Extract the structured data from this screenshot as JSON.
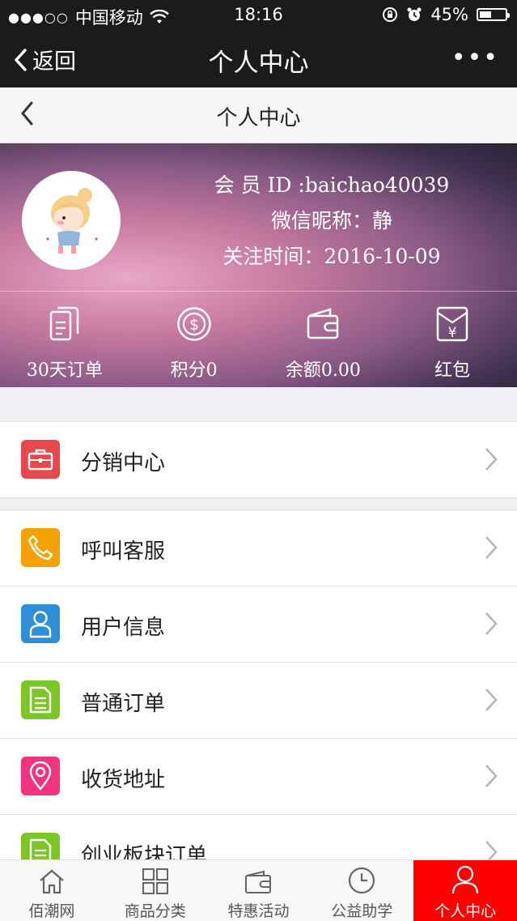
{
  "status": {
    "carrier": "中国移动",
    "time": "18:16",
    "battery": "45%"
  },
  "nav": {
    "back_label": "返回",
    "title": "个人中心",
    "more": "•••"
  },
  "subnav": {
    "title": "个人中心"
  },
  "profile": {
    "member_id": "会 员 ID :baichao40039",
    "nickname": "微信昵称：静",
    "follow_time": "关注时间：2016-10-09"
  },
  "stats": [
    {
      "label": "30天订单",
      "icon": "document-icon"
    },
    {
      "label": "积分0",
      "icon": "dollar-coin-icon"
    },
    {
      "label": "余额0.00",
      "icon": "wallet-icon"
    },
    {
      "label": "红包",
      "icon": "yen-envelope-icon"
    }
  ],
  "menu_group1": [
    {
      "label": "分销中心",
      "icon": "briefcase-icon",
      "color": "#e8474b"
    }
  ],
  "menu_group2": [
    {
      "label": "呼叫客服",
      "icon": "phone-icon",
      "color": "#f5a200"
    },
    {
      "label": "用户信息",
      "icon": "user-icon",
      "color": "#2f8fd6"
    },
    {
      "label": "普通订单",
      "icon": "order-icon",
      "color": "#7cc627"
    },
    {
      "label": "收货地址",
      "icon": "location-pin-icon",
      "color": "#f0347e"
    },
    {
      "label": "创业板块订单",
      "icon": "order-icon",
      "color": "#7cc627"
    }
  ],
  "tabs": [
    {
      "label": "佰潮网",
      "icon": "home-icon"
    },
    {
      "label": "商品分类",
      "icon": "grid-icon"
    },
    {
      "label": "特惠活动",
      "icon": "wallet-icon"
    },
    {
      "label": "公益助学",
      "icon": "clock-icon"
    },
    {
      "label": "个人中心",
      "icon": "person-icon",
      "active": true
    }
  ],
  "colors": {
    "active_tab": "#ff0000",
    "dark_bar": "#1b1b1d"
  }
}
